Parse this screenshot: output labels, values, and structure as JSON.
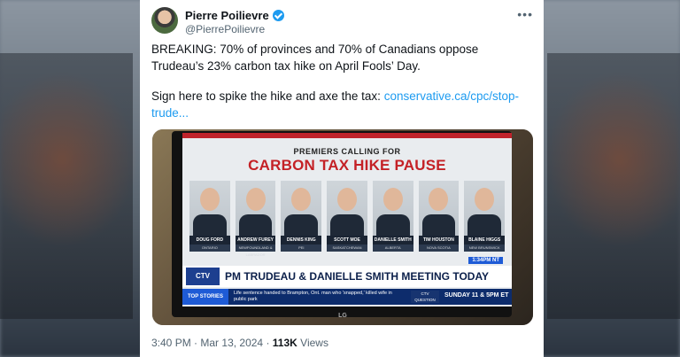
{
  "tweet": {
    "author_name": "Pierre Poilievre",
    "author_handle": "@PierrePoilievre",
    "text_line1": "BREAKING: 70% of provinces and 70% of Canadians oppose Trudeau’s 23% carbon tax hike on April Fools’ Day.",
    "text_line2": "Sign here to spike the hike and axe the tax:",
    "link_text": "conservative.ca/cpc/stop-trude...",
    "time": "3:40 PM",
    "date": "Mar 13, 2024",
    "views_count": "113K",
    "views_label": "Views"
  },
  "media": {
    "subtitle": "PREMIERS CALLING FOR",
    "headline": "CARBON TAX HIKE PAUSE",
    "premiers": [
      {
        "name": "DOUG FORD",
        "region": "ONTARIO"
      },
      {
        "name": "ANDREW FUREY",
        "region": "NEWFOUNDLAND & LABRADOR"
      },
      {
        "name": "DENNIS KING",
        "region": "PEI"
      },
      {
        "name": "SCOTT MOE",
        "region": "SASKATCHEWAN"
      },
      {
        "name": "DANIELLE SMITH",
        "region": "ALBERTA"
      },
      {
        "name": "TIM HOUSTON",
        "region": "NOVA SCOTIA"
      },
      {
        "name": "BLAINE HIGGS",
        "region": "NEW BRUNSWICK"
      }
    ],
    "time_badge": "1:34PM NT",
    "channel_logo": "CTV NEWS CHANNEL",
    "lower_third": "PM TRUDEAU & DANIELLE SMITH MEETING TODAY",
    "ticker_tag": "TOP STORIES",
    "ticker_text": "Life sentence handed to Brampton, Ont. man who 'snapped,' killed wife in public park",
    "program_logo": "CTV QUESTION PERIOD",
    "program_time": "SUNDAY 11 & 5PM ET",
    "tv_brand": "LG"
  },
  "colors": {
    "accent": "#1d9bf0",
    "text": "#0f1419",
    "muted": "#536471",
    "headline_red": "#c42126"
  },
  "icons": {
    "verified": "verified-badge-icon",
    "more": "more-options-icon"
  }
}
